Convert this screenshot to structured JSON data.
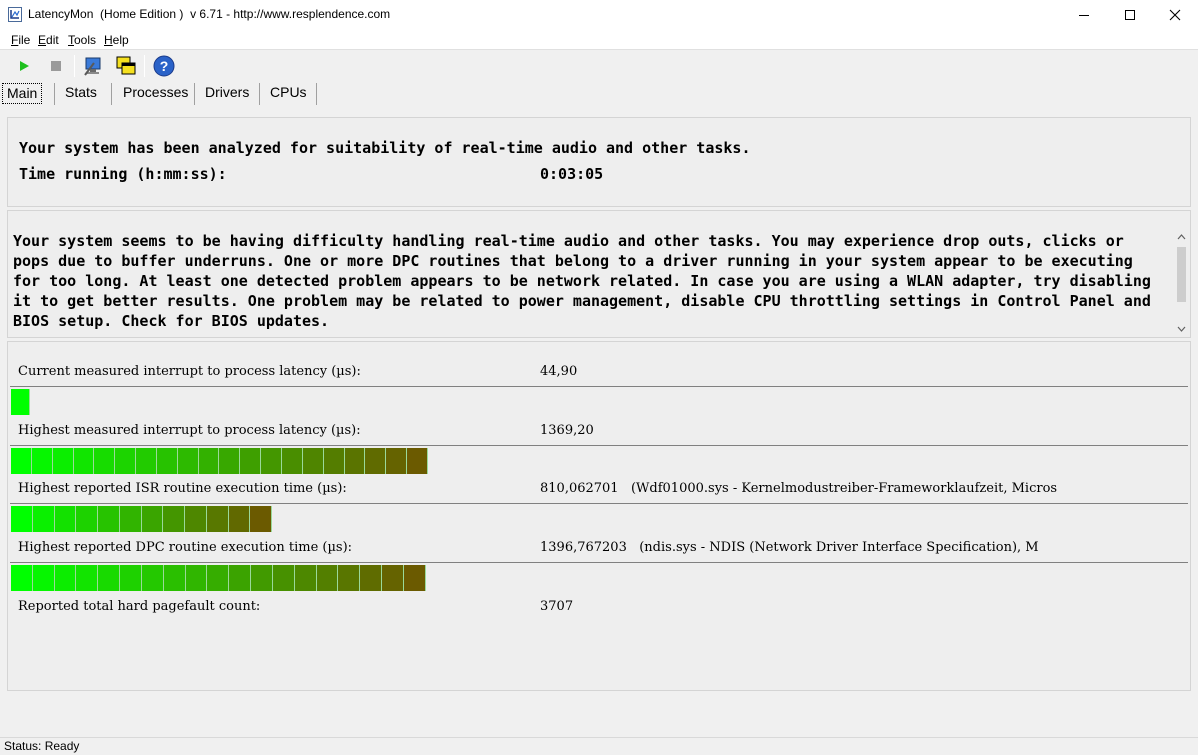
{
  "window": {
    "title": "LatencyMon  (Home Edition )  v 6.71 - http://www.resplendence.com"
  },
  "menu": [
    "File",
    "Edit",
    "Tools",
    "Help"
  ],
  "toolbar": {
    "icons": [
      "play-icon",
      "stop-icon",
      "monitor-icon",
      "windows-icon",
      "help-icon"
    ]
  },
  "tabs": [
    "Main",
    "Stats",
    "Processes",
    "Drivers",
    "CPUs"
  ],
  "summary": {
    "analyzed": "Your system has been analyzed for suitability of real-time audio and other tasks.",
    "time_label": "Time running (h:mm:ss):",
    "time_value": "0:03:05"
  },
  "verdict": "Your system seems to be having difficulty handling real-time audio and other tasks. You may experience drop outs, clicks or pops due to buffer underruns. One or more DPC routines that belong to a driver running in your system appear to be executing for too long. At least one detected problem appears to be network related. In case you are using a WLAN adapter, try disabling it to get better results. One problem may be related to power management, disable CPU throttling settings in Control Panel and BIOS setup. Check for BIOS updates.",
  "metrics": [
    {
      "label": "Current measured interrupt to process latency (µs):",
      "value": "44,90",
      "bar_level": 0.016,
      "bar_segments": 1
    },
    {
      "label": "Highest measured interrupt to process latency (µs):",
      "value": "1369,20",
      "bar_level": 0.355,
      "bar_segments": 20
    },
    {
      "label": "Highest reported ISR routine execution time (µs):",
      "value": "810,062701   (Wdf01000.sys - Kernelmodustreiber-Frameworklaufzeit, Micros",
      "bar_level": 0.222,
      "bar_segments": 12
    },
    {
      "label": "Highest reported DPC routine execution time (µs):",
      "value": "1396,767203   (ndis.sys - NDIS (Network Driver Interface Specification), M",
      "bar_level": 0.353,
      "bar_segments": 19
    },
    {
      "label": "Reported total hard pagefault count:",
      "value": "3707"
    }
  ],
  "status": "Status: Ready",
  "colors": {
    "bar_start": "#00ff00",
    "bar_end": "#6b5a00"
  }
}
